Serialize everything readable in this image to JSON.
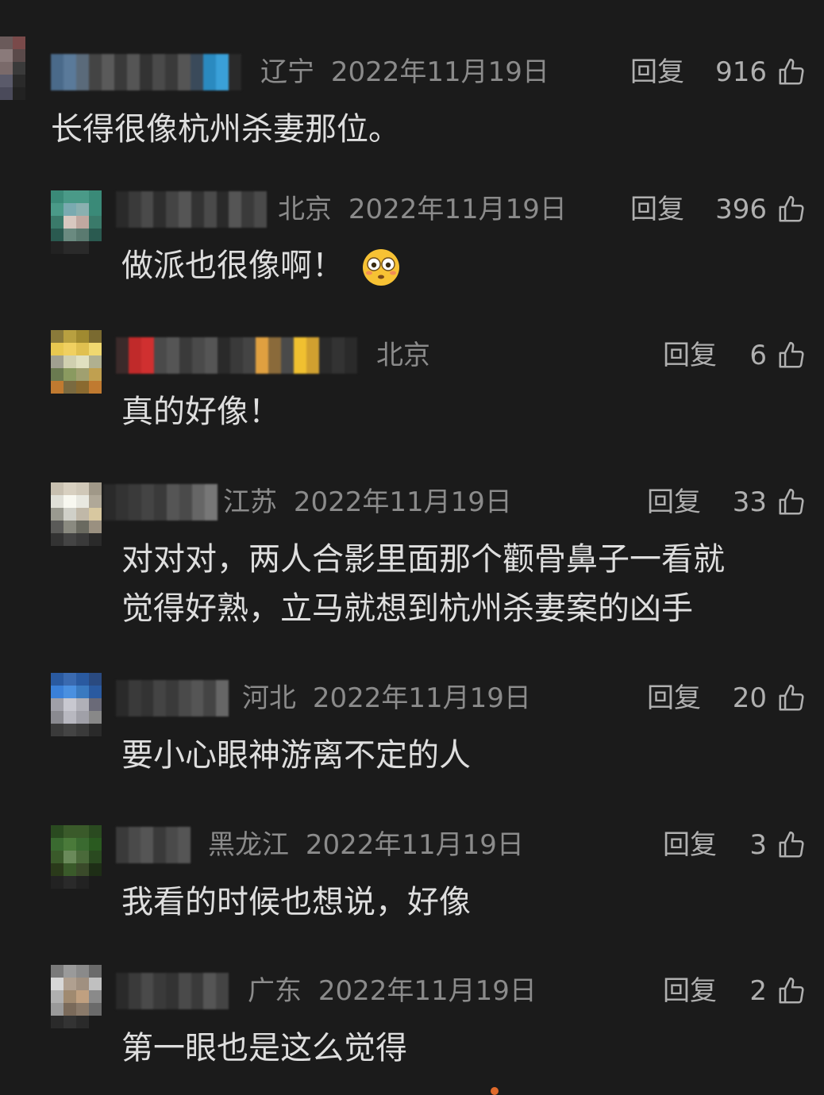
{
  "comments": [
    {
      "location": "辽宁",
      "date": "2022年11月19日",
      "reply": "回复",
      "likes": "916",
      "text": "长得很像杭州杀妻那位。"
    },
    {
      "location": "北京",
      "date": "2022年11月19日",
      "reply": "回复",
      "likes": "396",
      "text": "做派也很像啊！",
      "emoji": "flushed-face-emoji"
    },
    {
      "location": "北京",
      "date": "",
      "reply": "回复",
      "likes": "6",
      "text": "真的好像！"
    },
    {
      "location": "江苏",
      "date": "2022年11月19日",
      "reply": "回复",
      "likes": "33",
      "text_line1": "对对对，两人合影里面那个颧骨鼻子一看就",
      "text_line2": "觉得好熟，立马就想到杭州杀妻案的凶手"
    },
    {
      "location": "河北",
      "date": "2022年11月19日",
      "reply": "回复",
      "likes": "20",
      "text": "要小心眼神游离不定的人"
    },
    {
      "location": "黑龙江",
      "date": "2022年11月19日",
      "reply": "回复",
      "likes": "3",
      "text": "我看的时候也想说，好像"
    },
    {
      "location": "广东",
      "date": "2022年11月19日",
      "reply": "回复",
      "likes": "2",
      "text": "第一眼也是这么觉得"
    }
  ],
  "icons": {
    "like": "thumbs-up-icon"
  },
  "colors": {
    "background": "#1b1b1b",
    "meta": "#8b8b8b",
    "text": "#dedede"
  }
}
